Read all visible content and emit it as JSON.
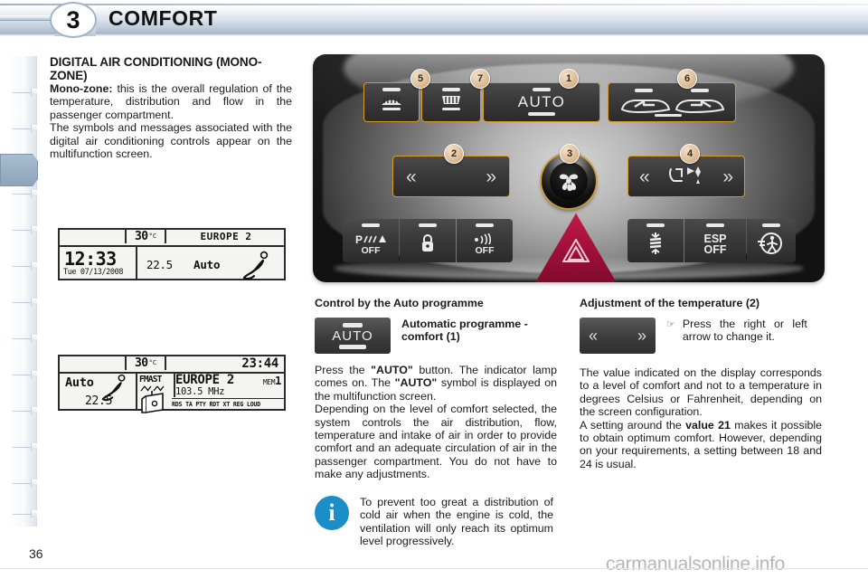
{
  "header": {
    "chapter_number": "3",
    "title": "COMFORT"
  },
  "left_column": {
    "section_title": "DIGITAL AIR CONDITIONING (MONO-ZONE)",
    "paragraph1_lead": "Mono-zone:",
    "paragraph1_rest": " this is the overall regulation of the temperature, distribution and flow in the passenger compartment.",
    "paragraph2": "The symbols and messages associated with the digital air conditioning controls appear on the multifunction screen."
  },
  "lcd_screen_1": {
    "temperature": "30",
    "temperature_unit": "°C",
    "station": "EUROPE 2",
    "time": "12:33",
    "date": "Tue 07/13/2008",
    "cabin_temp": "22.5",
    "mode": "Auto"
  },
  "lcd_screen_2": {
    "temperature": "30",
    "temperature_unit": "°C",
    "time": "23:44",
    "mode": "Auto",
    "cabin_temp": "22.5",
    "band": "FMAST",
    "station": "EUROPE 2",
    "memory": "MEM",
    "memory_number": "1",
    "frequency": "103.5 MHz",
    "rds_flags": "RDS TA PTY RDT XT REG LOUD"
  },
  "control_panel": {
    "buttons": {
      "rear_demist": "rear-demist-icon",
      "windscreen_demist": "windscreen-demist-icon",
      "auto": "AUTO",
      "air_recirculation_left": "air-intake-external-icon",
      "air_recirculation_right": "air-recirculation-icon",
      "temp_left_arrow": "«",
      "temp_right_arrow": "»",
      "dist_left_arrow": "«",
      "dist_right_arrow": "»",
      "air_distribution": "air-distribution-icon",
      "fan_knob": "fan-icon",
      "hazard": "hazard-warning-icon",
      "park_assist": "P",
      "park_assist_off": "OFF",
      "central_lock": "lock-icon",
      "alarm_label": "OFF",
      "suspension": "suspension-icon",
      "esp_line1": "ESP",
      "esp_line2": "OFF",
      "child_safety": "child-safety-icon"
    },
    "callouts": [
      "5",
      "7",
      "1",
      "6",
      "2",
      "3",
      "4"
    ]
  },
  "middle_column": {
    "heading": "Control by the Auto programme",
    "thumb_caption": "Automatic programme - comfort (1)",
    "thumb_label": "AUTO",
    "paragraph1_a": "Press the ",
    "paragraph1_b": "\"AUTO\"",
    "paragraph1_c": " button. The indicator lamp comes on. The ",
    "paragraph1_d": "\"AUTO\"",
    "paragraph1_e": " symbol is displayed on the multifunction screen.",
    "paragraph2": "Depending on the level of comfort selected, the system controls the air distribution, flow, temperature and intake of air in order to provide comfort and an adequate circulation of air in the passenger compartment. You do not have to make any adjustments."
  },
  "right_column": {
    "heading": "Adjustment of the temperature (2)",
    "bullet": "Press the right or left arrow to change it.",
    "left_arrow": "«",
    "right_arrow": "»",
    "paragraph1": "The value indicated on the display corresponds to a level of comfort and not to a temperature in degrees Celsius or Fahrenheit, depending on the screen configuration.",
    "paragraph2_a": "A setting around the ",
    "paragraph2_b": "value 21",
    "paragraph2_c": " makes it possible to obtain optimum comfort. However, depending on your requirements, a setting between 18 and 24 is usual."
  },
  "note": {
    "icon": "info-icon",
    "text": "To prevent too great a distribution of cold air when the engine is cold, the ventilation will only reach its optimum level progressively."
  },
  "footer": {
    "page_number": "36",
    "watermark": "carmanualsonline.info"
  },
  "colors": {
    "highlight_orange": "#d79a2b",
    "info_blue": "#1b8ec7",
    "hazard_red": "#9d0f39",
    "tab_active": "#9ab0c5"
  }
}
